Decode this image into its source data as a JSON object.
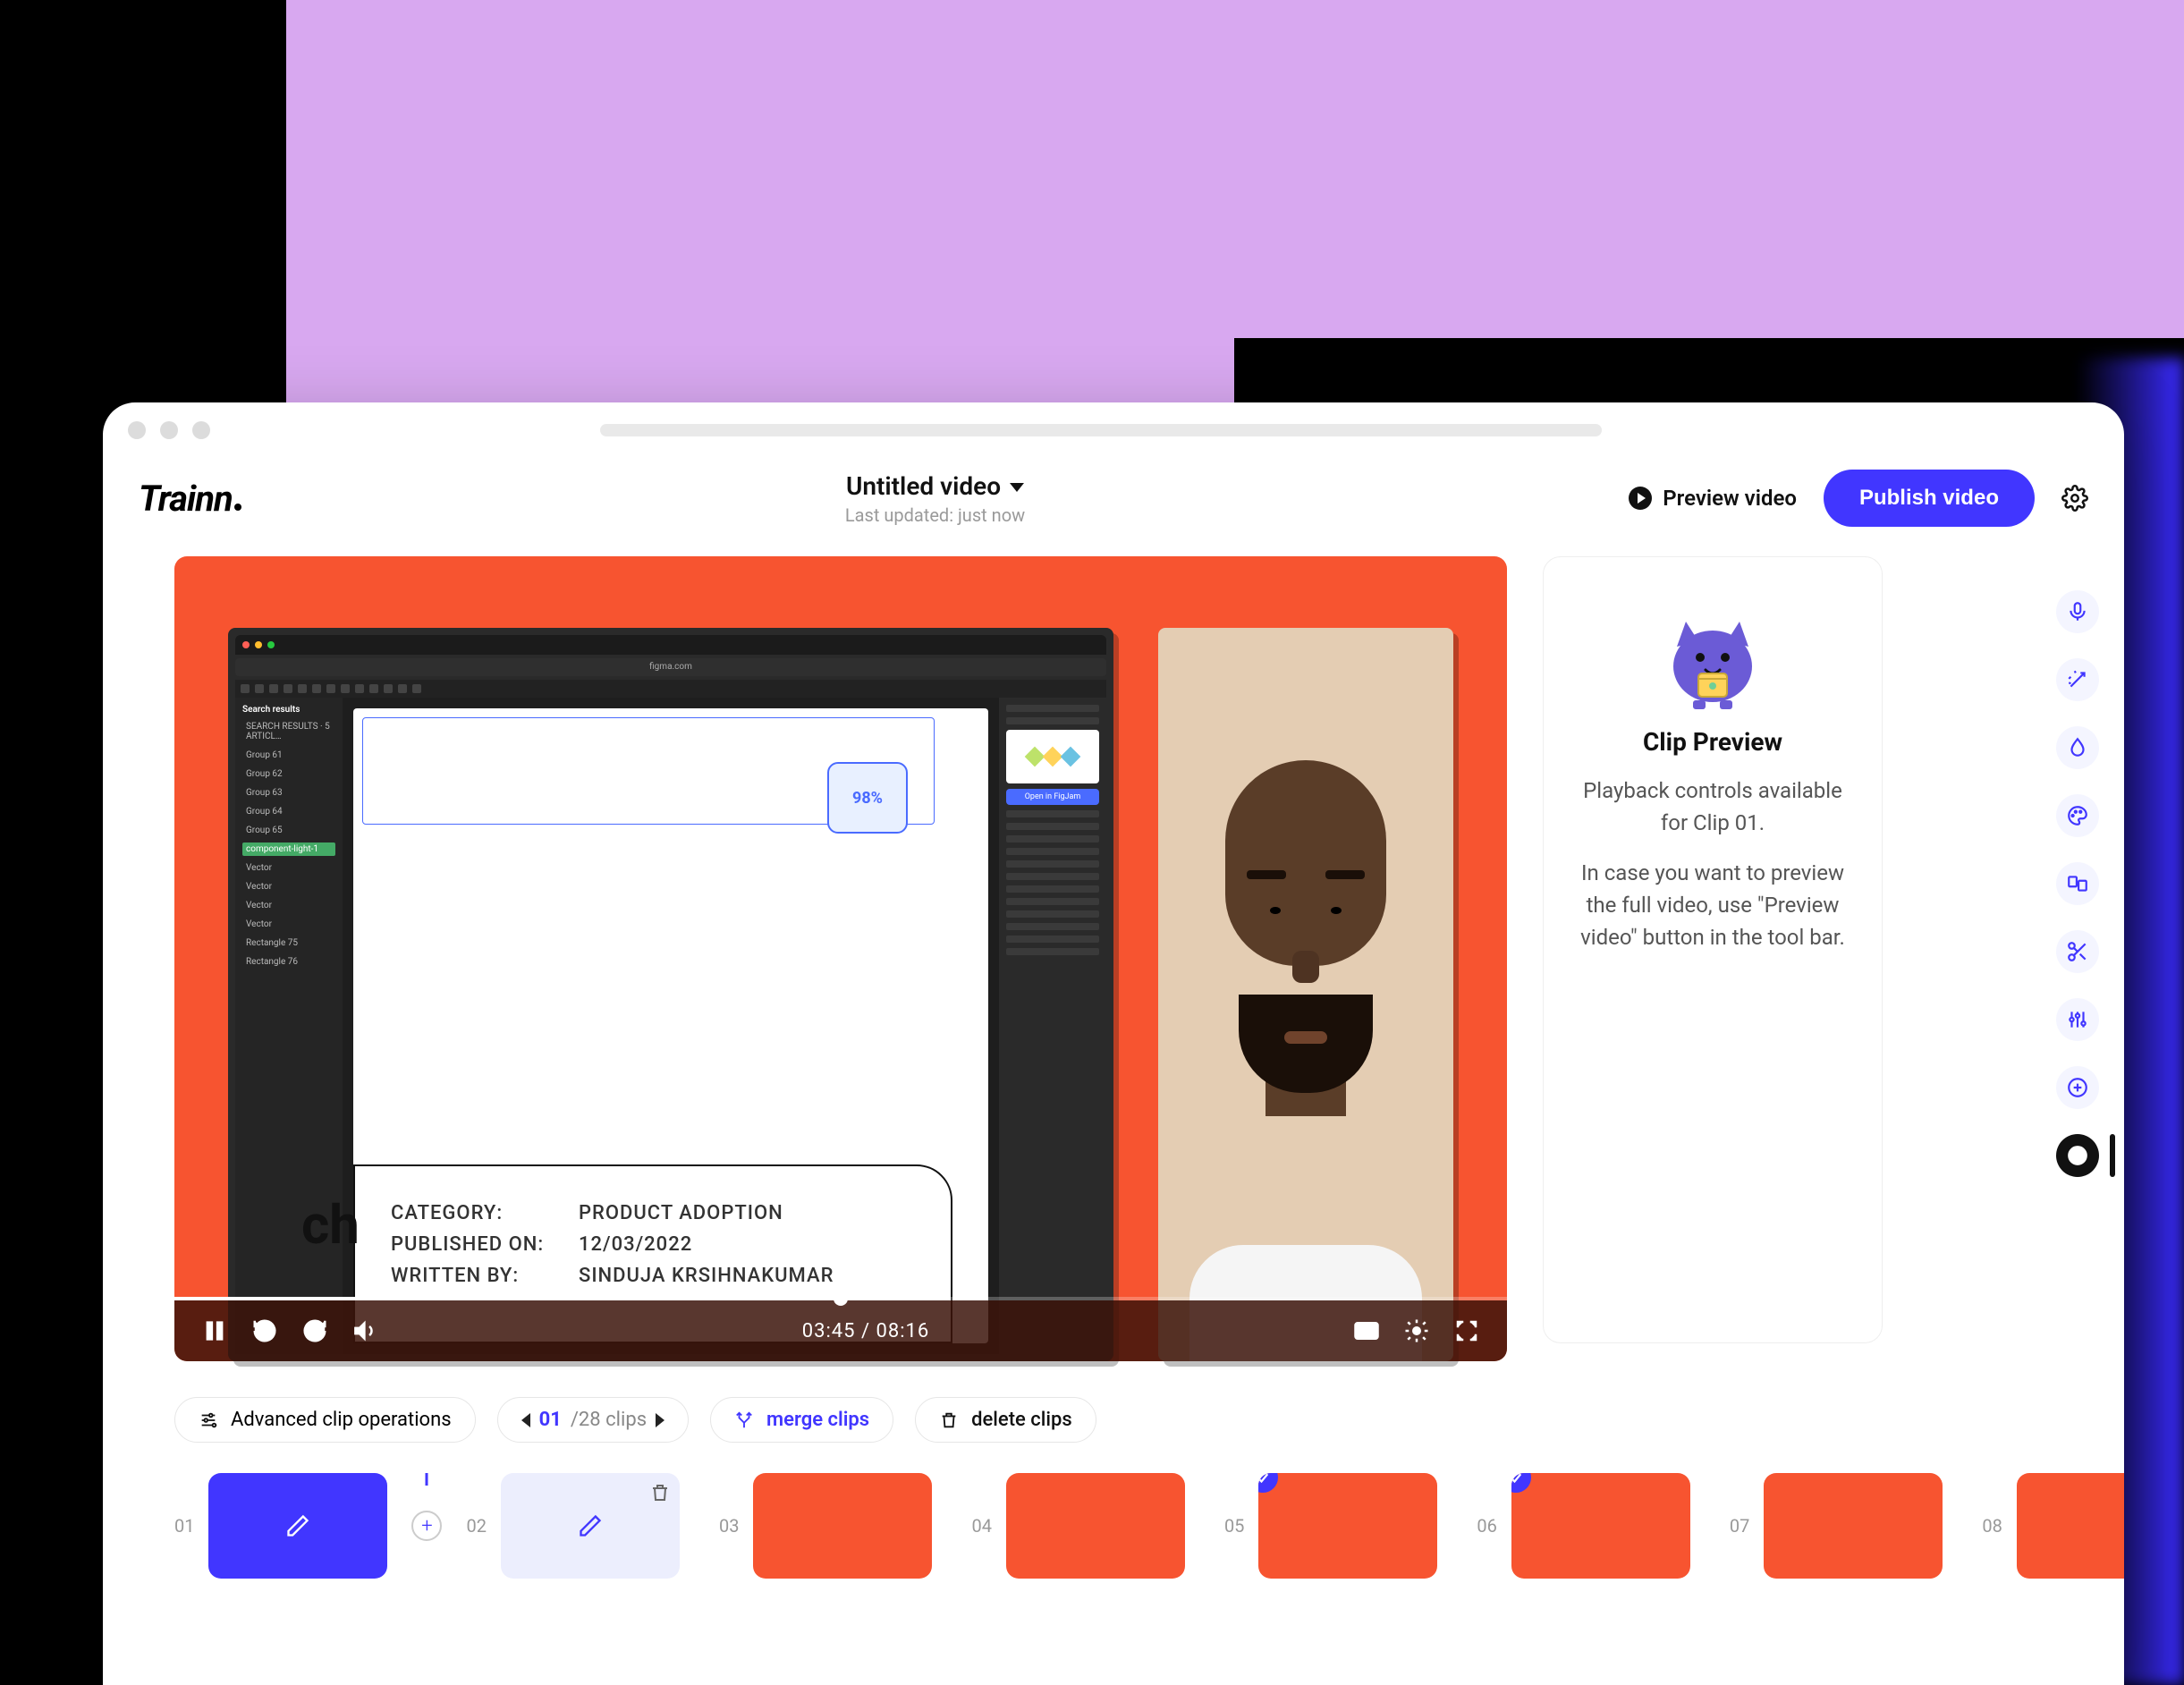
{
  "brand": "Trainn",
  "header": {
    "title": "Untitled video",
    "subtitle": "Last updated: just now",
    "preview_label": "Preview video",
    "publish_label": "Publish video"
  },
  "video": {
    "timestamp": "03:45 / 08:16",
    "progress_pct": 50,
    "recording": {
      "url": "figma.com",
      "side_heading": "Search results",
      "side_items": [
        "SEARCH RESULTS · 5 ARTICL…",
        "Group 61",
        "Group 62",
        "Group 63",
        "Group 64",
        "Group 65",
        "component-light-1",
        "Vector",
        "Vector",
        "Vector",
        "Vector",
        "Rectangle 75",
        "Rectangle 76"
      ],
      "badge_value": "98%",
      "card_left_char": "ch",
      "rows": [
        {
          "label": "CATEGORY:",
          "value": "PRODUCT ADOPTION"
        },
        {
          "label": "PUBLISHED ON:",
          "value": "12/03/2022"
        },
        {
          "label": "WRITTEN BY:",
          "value": "SINDUJA KRSIHNAKUMAR"
        }
      ],
      "inspector_btn": "Open in FigJam"
    }
  },
  "panel": {
    "title": "Clip Preview",
    "line1": "Playback controls available for Clip 01.",
    "line2": "In case you want to preview the full video, use \"Preview video\" button in the tool bar."
  },
  "rail_icons": [
    "mic",
    "magic-wand",
    "droplet",
    "palette",
    "layers",
    "scissors",
    "adjustments",
    "add-ring",
    "clip-playback"
  ],
  "ops": {
    "advanced_label": "Advanced clip operations",
    "current": "01",
    "total": "/28 clips",
    "merge_label": "merge clips",
    "delete_label": "delete clips"
  },
  "clips": [
    {
      "num": "01",
      "type": "blue",
      "editable": true
    },
    {
      "num": "02",
      "type": "pale",
      "editable": true,
      "deletable": true
    },
    {
      "num": "03",
      "type": "real"
    },
    {
      "num": "04",
      "type": "real"
    },
    {
      "num": "05",
      "type": "real",
      "checked": true
    },
    {
      "num": "06",
      "type": "real",
      "checked": true
    },
    {
      "num": "07",
      "type": "real"
    },
    {
      "num": "08",
      "type": "real",
      "last": true
    }
  ],
  "colors": {
    "accent": "#4136ff",
    "video_bg": "#f75430"
  }
}
